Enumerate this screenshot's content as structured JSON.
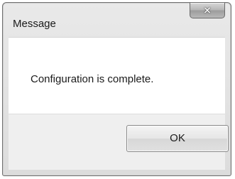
{
  "window": {
    "title": "Message",
    "close_icon": "close-icon",
    "close_glyph": "✕"
  },
  "body": {
    "message": "Configuration is complete."
  },
  "footer": {
    "ok_label": "OK"
  }
}
